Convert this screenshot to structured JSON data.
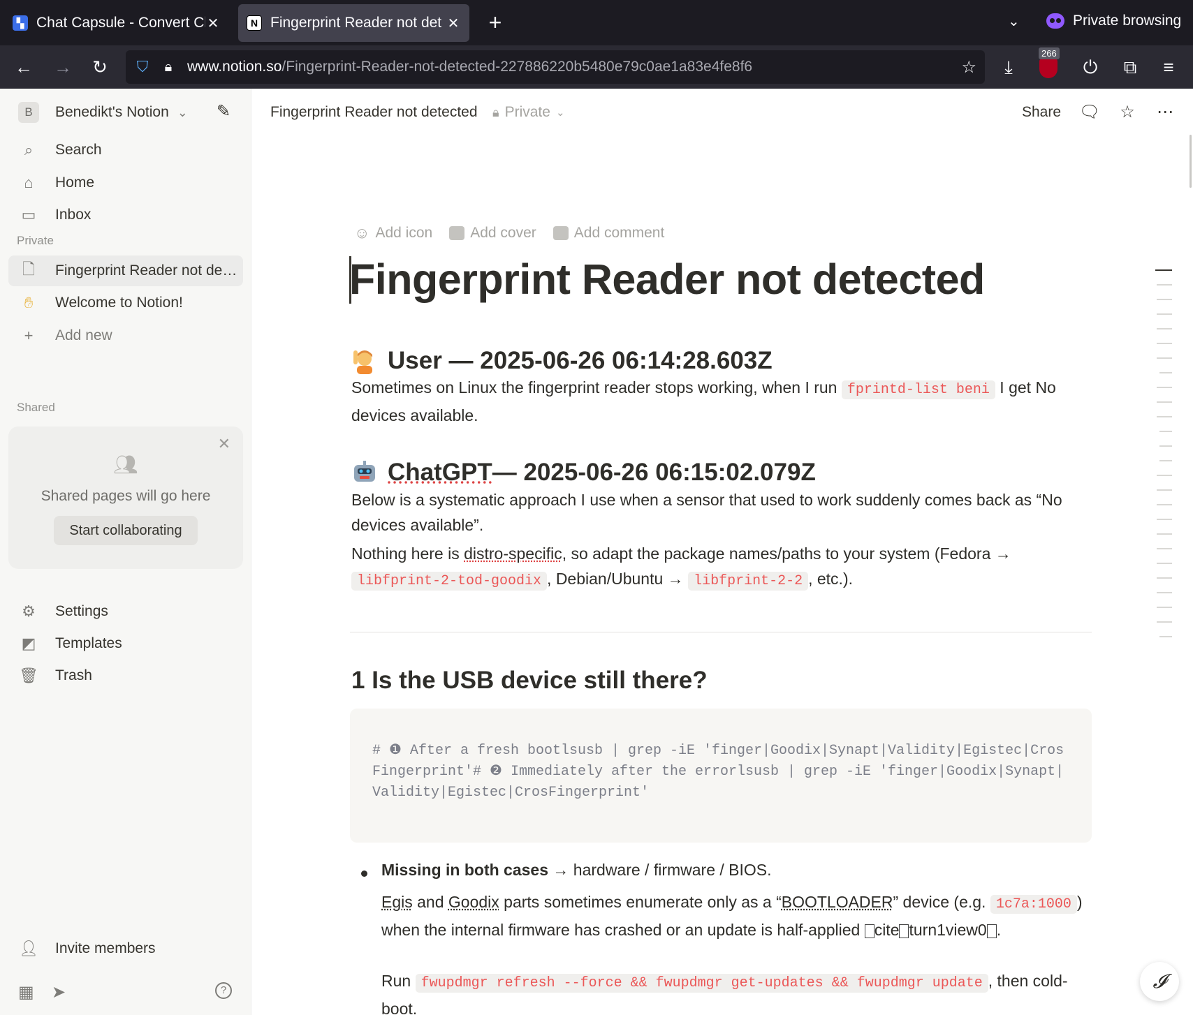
{
  "browser": {
    "tabs": [
      {
        "title": "Chat Capsule - Convert Cha",
        "icon": "chat-capsule-favicon",
        "active": false
      },
      {
        "title": "Fingerprint Reader not det",
        "icon": "notion-favicon",
        "active": true
      }
    ],
    "private_label": "Private browsing",
    "url_domain": "www.notion.so",
    "url_path": "/Fingerprint-Reader-not-detected-227886220b5480e79c0ae1a83e4fe8f6",
    "ublock_count": "266"
  },
  "sidebar": {
    "workspace_initial": "B",
    "workspace_name": "Benedikt's Notion",
    "nav": [
      {
        "label": "Search",
        "icon": "search-icon"
      },
      {
        "label": "Home",
        "icon": "home-icon"
      },
      {
        "label": "Inbox",
        "icon": "inbox-icon"
      }
    ],
    "private_section": "Private",
    "pages": [
      {
        "label": "Fingerprint Reader not detected",
        "icon": "page-icon",
        "active": true
      },
      {
        "label": "Welcome to Notion!",
        "icon": "waving-hand-icon",
        "active": false
      }
    ],
    "add_new": "Add new",
    "shared_section": "Shared",
    "shared_placeholder": "Shared pages will go here",
    "start_collaborating": "Start collaborating",
    "bottom_nav": [
      {
        "label": "Settings",
        "icon": "gear-icon"
      },
      {
        "label": "Templates",
        "icon": "templates-icon"
      },
      {
        "label": "Trash",
        "icon": "trash-icon"
      }
    ],
    "invite": "Invite members"
  },
  "topbar": {
    "title": "Fingerprint Reader not detected",
    "privacy": "Private",
    "share": "Share"
  },
  "page": {
    "add_icon": "Add icon",
    "add_cover": "Add cover",
    "add_comment": "Add comment",
    "title": "Fingerprint Reader not detected",
    "user_heading": "User — 2025-06-26 06:14:28.603Z",
    "user_text_1": "Sometimes on Linux the fingerprint reader stops working, when I run ",
    "user_code": "fprintd-list  beni",
    "user_text_2": " I get No devices available.",
    "bot_heading_name": "ChatGPT",
    "bot_heading_rest": " — 2025-06-26 06:15:02.079Z",
    "bot_p1": "Below is a systematic approach I use when a sensor that used to work suddenly comes back as “No devices available”.",
    "bot_p2_a": "Nothing here is ",
    "bot_p2_squig": "distro-specific",
    "bot_p2_b": ", so adapt the package names/paths to your system (Fedora → ",
    "bot_p2_code1": "libfprint-2-tod-goodix",
    "bot_p2_c": ", Debian/Ubuntu → ",
    "bot_p2_code2": "libfprint-2-2",
    "bot_p2_d": ", etc.).",
    "section_heading": "1 Is the USB device still there?",
    "code_block": "# ❶ After a fresh bootlsusb | grep -iE 'finger|Goodix|Synapt|Validity|Egistec|CrosFingerprint'# ❷ Immediately after the errorlsusb | grep -iE 'finger|Goodix|Synapt|Validity|Egistec|CrosFingerprint'",
    "bullet_bold": "Missing in both cases",
    "bullet_rest": " → hardware / firmware / BIOS.",
    "b_p1_egis": "Egis",
    "b_p1_and": " and ",
    "b_p1_goodix": "Goodix",
    "b_p1_a": " parts sometimes enumerate only as a “",
    "b_p1_boot": "BOOTLOADER",
    "b_p1_b": "” device (e.g. ",
    "b_p1_code": "1c7a:1000",
    "b_p1_c": ") when the internal firmware has crashed or an update is half-applied ",
    "b_p1_cite": "cite",
    "b_p1_turn": "turn1view0",
    "b_p1_end": ".",
    "b_p2_a": "Run ",
    "b_p2_code": "fwupdmgr refresh --force && fwupdmgr get-updates && fwupdmgr update",
    "b_p2_b": ", then cold-boot."
  }
}
